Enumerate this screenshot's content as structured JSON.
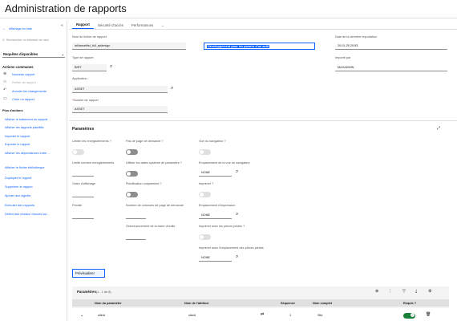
{
  "page": {
    "title": "Administration de rapports"
  },
  "sidebar": {
    "back_label": "Affichage en liste",
    "search_placeholder": "Rechercher un élément de navi",
    "select_label": "Requêtes disponibles",
    "common_actions_title": "Actions communes",
    "common_actions": [
      {
        "label": "Nouveau rapport",
        "enabled": true
      },
      {
        "label": "Retirer du rapport",
        "enabled": false
      },
      {
        "label": "Annuler les changements",
        "enabled": true
      },
      {
        "label": "Créer un rapport",
        "enabled": true
      }
    ],
    "more_actions_title": "Plus d'actions",
    "more_actions": [
      "Afficher le traitement du rapport",
      "Afficher les rapports planifiés",
      "Importer le rapport",
      "Exporter le rapport",
      "Afficher les dépendances entre ...",
      "Afficher le fichier bibliothèque",
      "Dupliquer le rapport",
      "Supprimer le rapport",
      "Ajouter aux signets",
      "Exécuter des rapports",
      "Définir des niveaux d'accès sur..."
    ]
  },
  "tabs": [
    {
      "label": "Rapport",
      "active": true
    },
    {
      "label": "Sécurité d'accès",
      "active": false
    },
    {
      "label": "Performances",
      "active": false
    }
  ],
  "form": {
    "file_name_label": "Nom du fichier de rapport",
    "file_name_value": "drillassetlist_full_rptdesign",
    "description_value": "Développement pour les pannes d'un actif",
    "last_import_label": "Date de la dernière importation",
    "last_import_value": "20.01.25 20:53",
    "report_type_label": "Type de rapport",
    "report_type_value": "BIRT",
    "imported_by_label": "Importé par",
    "imported_by_value": "MAXADMIN",
    "application_label": "Application",
    "application_value": "ASSET",
    "report_folder_label": "Dossier de rapport",
    "report_folder_value": "ASSET"
  },
  "parameters_section": {
    "title": "Paramètres",
    "limit_records_label": "Limiter les enregistrements ?",
    "limit_records_value": "",
    "no_request_page_label": "Pas de page de demande ?",
    "toolbar_label": "Vue du navigateur ?",
    "limit_count_label": "Limite nombre enregistrements",
    "use_customer_label": "Utiliser les dates système de paramètre ?",
    "browser_location_label": "Emplacement de la vue du navigateur",
    "browser_location_value": "NONE",
    "display_order_label": "Ordre d'affichage",
    "scheduled_only_label": "Planification uniquement ?",
    "print_label": "Imprimer ?",
    "priority_label": "Priorité",
    "request_page_columns_label": "Nombre de colonnes de page de demande",
    "print_location_label": "Emplacement d'impression",
    "print_location_value": "NONE",
    "print_with_attachments_label": "Imprimer avec les pièces jointes ?",
    "tool_order_label": "Ordonnancement de la barre d'outils",
    "print_attachment_location_label": "Imprimer avec l'emplacement des pièces jointes",
    "print_attachment_location_value": "NONE"
  },
  "buttons": {
    "preview_label": "Prévisualiser"
  },
  "param_table": {
    "title": "Paramètres",
    "count": "(1 - 1 de 8)",
    "headers": [
      "Nom du paramètre",
      "Nom de l'attribut",
      "Séquence",
      "Nom complet",
      "Requis ?"
    ],
    "rows": [
      {
        "param_name": "siteid",
        "attribute": "siteid",
        "sequence": "1",
        "full_name": "Site",
        "required": true
      }
    ]
  },
  "colors": {
    "accent": "#0f62fe",
    "toggle_on": "#198038"
  }
}
